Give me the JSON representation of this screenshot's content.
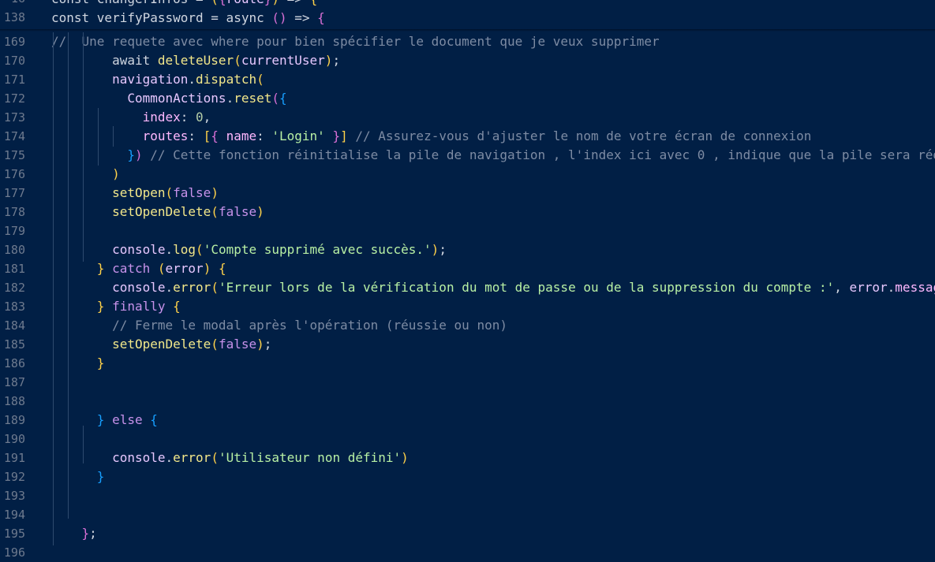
{
  "editor": {
    "sticky": [
      {
        "num": "16",
        "tokens": [
          {
            "t": "const changerInfos = ",
            "c": "plain"
          },
          {
            "t": "(",
            "c": "p1"
          },
          {
            "t": "{",
            "c": "p2"
          },
          {
            "t": "route",
            "c": "var"
          },
          {
            "t": "}",
            "c": "p2"
          },
          {
            "t": ")",
            "c": "p1"
          },
          {
            "t": " => ",
            "c": "plain"
          },
          {
            "t": "{",
            "c": "p1"
          }
        ]
      },
      {
        "num": "138",
        "tokens": [
          {
            "t": "  const verifyPassword = async ",
            "c": "plain"
          },
          {
            "t": "()",
            "c": "p2"
          },
          {
            "t": " => ",
            "c": "plain"
          },
          {
            "t": "{",
            "c": "p2"
          }
        ]
      }
    ],
    "lines": [
      {
        "num": "169",
        "tokens": [
          {
            "t": "//  Une requete avec where pour bien spécifier le document que je veux supprimer",
            "c": "cm"
          }
        ]
      },
      {
        "num": "170",
        "tokens": [
          {
            "t": "        await ",
            "c": "plain"
          },
          {
            "t": "deleteUser",
            "c": "fn"
          },
          {
            "t": "(",
            "c": "p1"
          },
          {
            "t": "currentUser",
            "c": "var"
          },
          {
            "t": ")",
            "c": "p1"
          },
          {
            "t": ";",
            "c": "plain"
          }
        ]
      },
      {
        "num": "171",
        "tokens": [
          {
            "t": "        ",
            "c": "plain"
          },
          {
            "t": "navigation",
            "c": "var"
          },
          {
            "t": ".",
            "c": "plain"
          },
          {
            "t": "dispatch",
            "c": "fn"
          },
          {
            "t": "(",
            "c": "p1"
          }
        ]
      },
      {
        "num": "172",
        "tokens": [
          {
            "t": "          ",
            "c": "plain"
          },
          {
            "t": "CommonActions",
            "c": "var"
          },
          {
            "t": ".",
            "c": "plain"
          },
          {
            "t": "reset",
            "c": "fn"
          },
          {
            "t": "(",
            "c": "p2"
          },
          {
            "t": "{",
            "c": "p3"
          }
        ]
      },
      {
        "num": "173",
        "tokens": [
          {
            "t": "            ",
            "c": "plain"
          },
          {
            "t": "index",
            "c": "prop"
          },
          {
            "t": ": ",
            "c": "plain"
          },
          {
            "t": "0",
            "c": "num"
          },
          {
            "t": ",",
            "c": "plain"
          }
        ]
      },
      {
        "num": "174",
        "tokens": [
          {
            "t": "            ",
            "c": "plain"
          },
          {
            "t": "routes",
            "c": "prop"
          },
          {
            "t": ": ",
            "c": "plain"
          },
          {
            "t": "[",
            "c": "p1"
          },
          {
            "t": "{",
            "c": "p2"
          },
          {
            "t": " ",
            "c": "plain"
          },
          {
            "t": "name",
            "c": "prop"
          },
          {
            "t": ": ",
            "c": "plain"
          },
          {
            "t": "'Login'",
            "c": "str"
          },
          {
            "t": " ",
            "c": "plain"
          },
          {
            "t": "}",
            "c": "p2"
          },
          {
            "t": "]",
            "c": "p1"
          },
          {
            "t": " // Assurez-vous d'ajuster le nom de votre écran de connexion",
            "c": "cm"
          }
        ]
      },
      {
        "num": "175",
        "tokens": [
          {
            "t": "          ",
            "c": "plain"
          },
          {
            "t": "}",
            "c": "p3"
          },
          {
            "t": ")",
            "c": "p2"
          },
          {
            "t": " // Cette fonction réinitialise la pile de navigation , l'index ici avec 0 , indique que la pile sera réduite",
            "c": "cm"
          }
        ]
      },
      {
        "num": "176",
        "tokens": [
          {
            "t": "        ",
            "c": "plain"
          },
          {
            "t": ")",
            "c": "p1"
          }
        ]
      },
      {
        "num": "177",
        "tokens": [
          {
            "t": "        ",
            "c": "plain"
          },
          {
            "t": "setOpen",
            "c": "fn"
          },
          {
            "t": "(",
            "c": "p1"
          },
          {
            "t": "false",
            "c": "kw"
          },
          {
            "t": ")",
            "c": "p1"
          }
        ]
      },
      {
        "num": "178",
        "tokens": [
          {
            "t": "        ",
            "c": "plain"
          },
          {
            "t": "setOpenDelete",
            "c": "fn"
          },
          {
            "t": "(",
            "c": "p1"
          },
          {
            "t": "false",
            "c": "kw"
          },
          {
            "t": ")",
            "c": "p1"
          }
        ]
      },
      {
        "num": "179",
        "tokens": []
      },
      {
        "num": "180",
        "tokens": [
          {
            "t": "        ",
            "c": "plain"
          },
          {
            "t": "console",
            "c": "var"
          },
          {
            "t": ".",
            "c": "plain"
          },
          {
            "t": "log",
            "c": "fn"
          },
          {
            "t": "(",
            "c": "p1"
          },
          {
            "t": "'Compte supprimé avec succès.'",
            "c": "str"
          },
          {
            "t": ")",
            "c": "p1"
          },
          {
            "t": ";",
            "c": "plain"
          }
        ]
      },
      {
        "num": "181",
        "tokens": [
          {
            "t": "      ",
            "c": "plain"
          },
          {
            "t": "}",
            "c": "p1"
          },
          {
            "t": " catch ",
            "c": "kw"
          },
          {
            "t": "(",
            "c": "p1"
          },
          {
            "t": "error",
            "c": "var"
          },
          {
            "t": ")",
            "c": "p1"
          },
          {
            "t": " ",
            "c": "plain"
          },
          {
            "t": "{",
            "c": "p1"
          }
        ]
      },
      {
        "num": "182",
        "tokens": [
          {
            "t": "        ",
            "c": "plain"
          },
          {
            "t": "console",
            "c": "var"
          },
          {
            "t": ".",
            "c": "plain"
          },
          {
            "t": "error",
            "c": "fn"
          },
          {
            "t": "(",
            "c": "p1"
          },
          {
            "t": "'Erreur lors de la vérification du mot de passe ou de la suppression du compte :'",
            "c": "str"
          },
          {
            "t": ", ",
            "c": "plain"
          },
          {
            "t": "error",
            "c": "var"
          },
          {
            "t": ".",
            "c": "plain"
          },
          {
            "t": "message",
            "c": "prop"
          },
          {
            "t": ")",
            "c": "p1"
          }
        ]
      },
      {
        "num": "183",
        "tokens": [
          {
            "t": "      ",
            "c": "plain"
          },
          {
            "t": "}",
            "c": "p1"
          },
          {
            "t": " finally ",
            "c": "kw"
          },
          {
            "t": "{",
            "c": "p1"
          }
        ]
      },
      {
        "num": "184",
        "tokens": [
          {
            "t": "        ",
            "c": "plain"
          },
          {
            "t": "// Ferme le modal après l'opération (réussie ou non)",
            "c": "cm"
          }
        ]
      },
      {
        "num": "185",
        "tokens": [
          {
            "t": "        ",
            "c": "plain"
          },
          {
            "t": "setOpenDelete",
            "c": "fn"
          },
          {
            "t": "(",
            "c": "p1"
          },
          {
            "t": "false",
            "c": "kw"
          },
          {
            "t": ")",
            "c": "p1"
          },
          {
            "t": ";",
            "c": "plain"
          }
        ]
      },
      {
        "num": "186",
        "tokens": [
          {
            "t": "      ",
            "c": "plain"
          },
          {
            "t": "}",
            "c": "p1"
          }
        ]
      },
      {
        "num": "187",
        "tokens": []
      },
      {
        "num": "188",
        "tokens": []
      },
      {
        "num": "189",
        "tokens": [
          {
            "t": "      ",
            "c": "plain"
          },
          {
            "t": "}",
            "c": "p3"
          },
          {
            "t": " else ",
            "c": "kw"
          },
          {
            "t": "{",
            "c": "p3"
          }
        ]
      },
      {
        "num": "190",
        "tokens": []
      },
      {
        "num": "191",
        "tokens": [
          {
            "t": "        ",
            "c": "plain"
          },
          {
            "t": "console",
            "c": "var"
          },
          {
            "t": ".",
            "c": "plain"
          },
          {
            "t": "error",
            "c": "fn"
          },
          {
            "t": "(",
            "c": "p1"
          },
          {
            "t": "'Utilisateur non défini'",
            "c": "str"
          },
          {
            "t": ")",
            "c": "p1"
          }
        ]
      },
      {
        "num": "192",
        "tokens": [
          {
            "t": "      ",
            "c": "plain"
          },
          {
            "t": "}",
            "c": "p3"
          }
        ]
      },
      {
        "num": "193",
        "tokens": []
      },
      {
        "num": "194",
        "tokens": []
      },
      {
        "num": "195",
        "tokens": [
          {
            "t": "    ",
            "c": "plain"
          },
          {
            "t": "}",
            "c": "p2"
          },
          {
            "t": ";",
            "c": "plain"
          }
        ]
      },
      {
        "num": "196",
        "tokens": []
      }
    ]
  },
  "colors": {
    "background": "#011f45",
    "line_number": "#6e7a8e",
    "comment": "#7d8ba3",
    "string": "#b8f0a4",
    "function": "#f3e78a",
    "bracket_1": "#ffd24a",
    "bracket_2": "#da70d6",
    "bracket_3": "#179fff"
  }
}
